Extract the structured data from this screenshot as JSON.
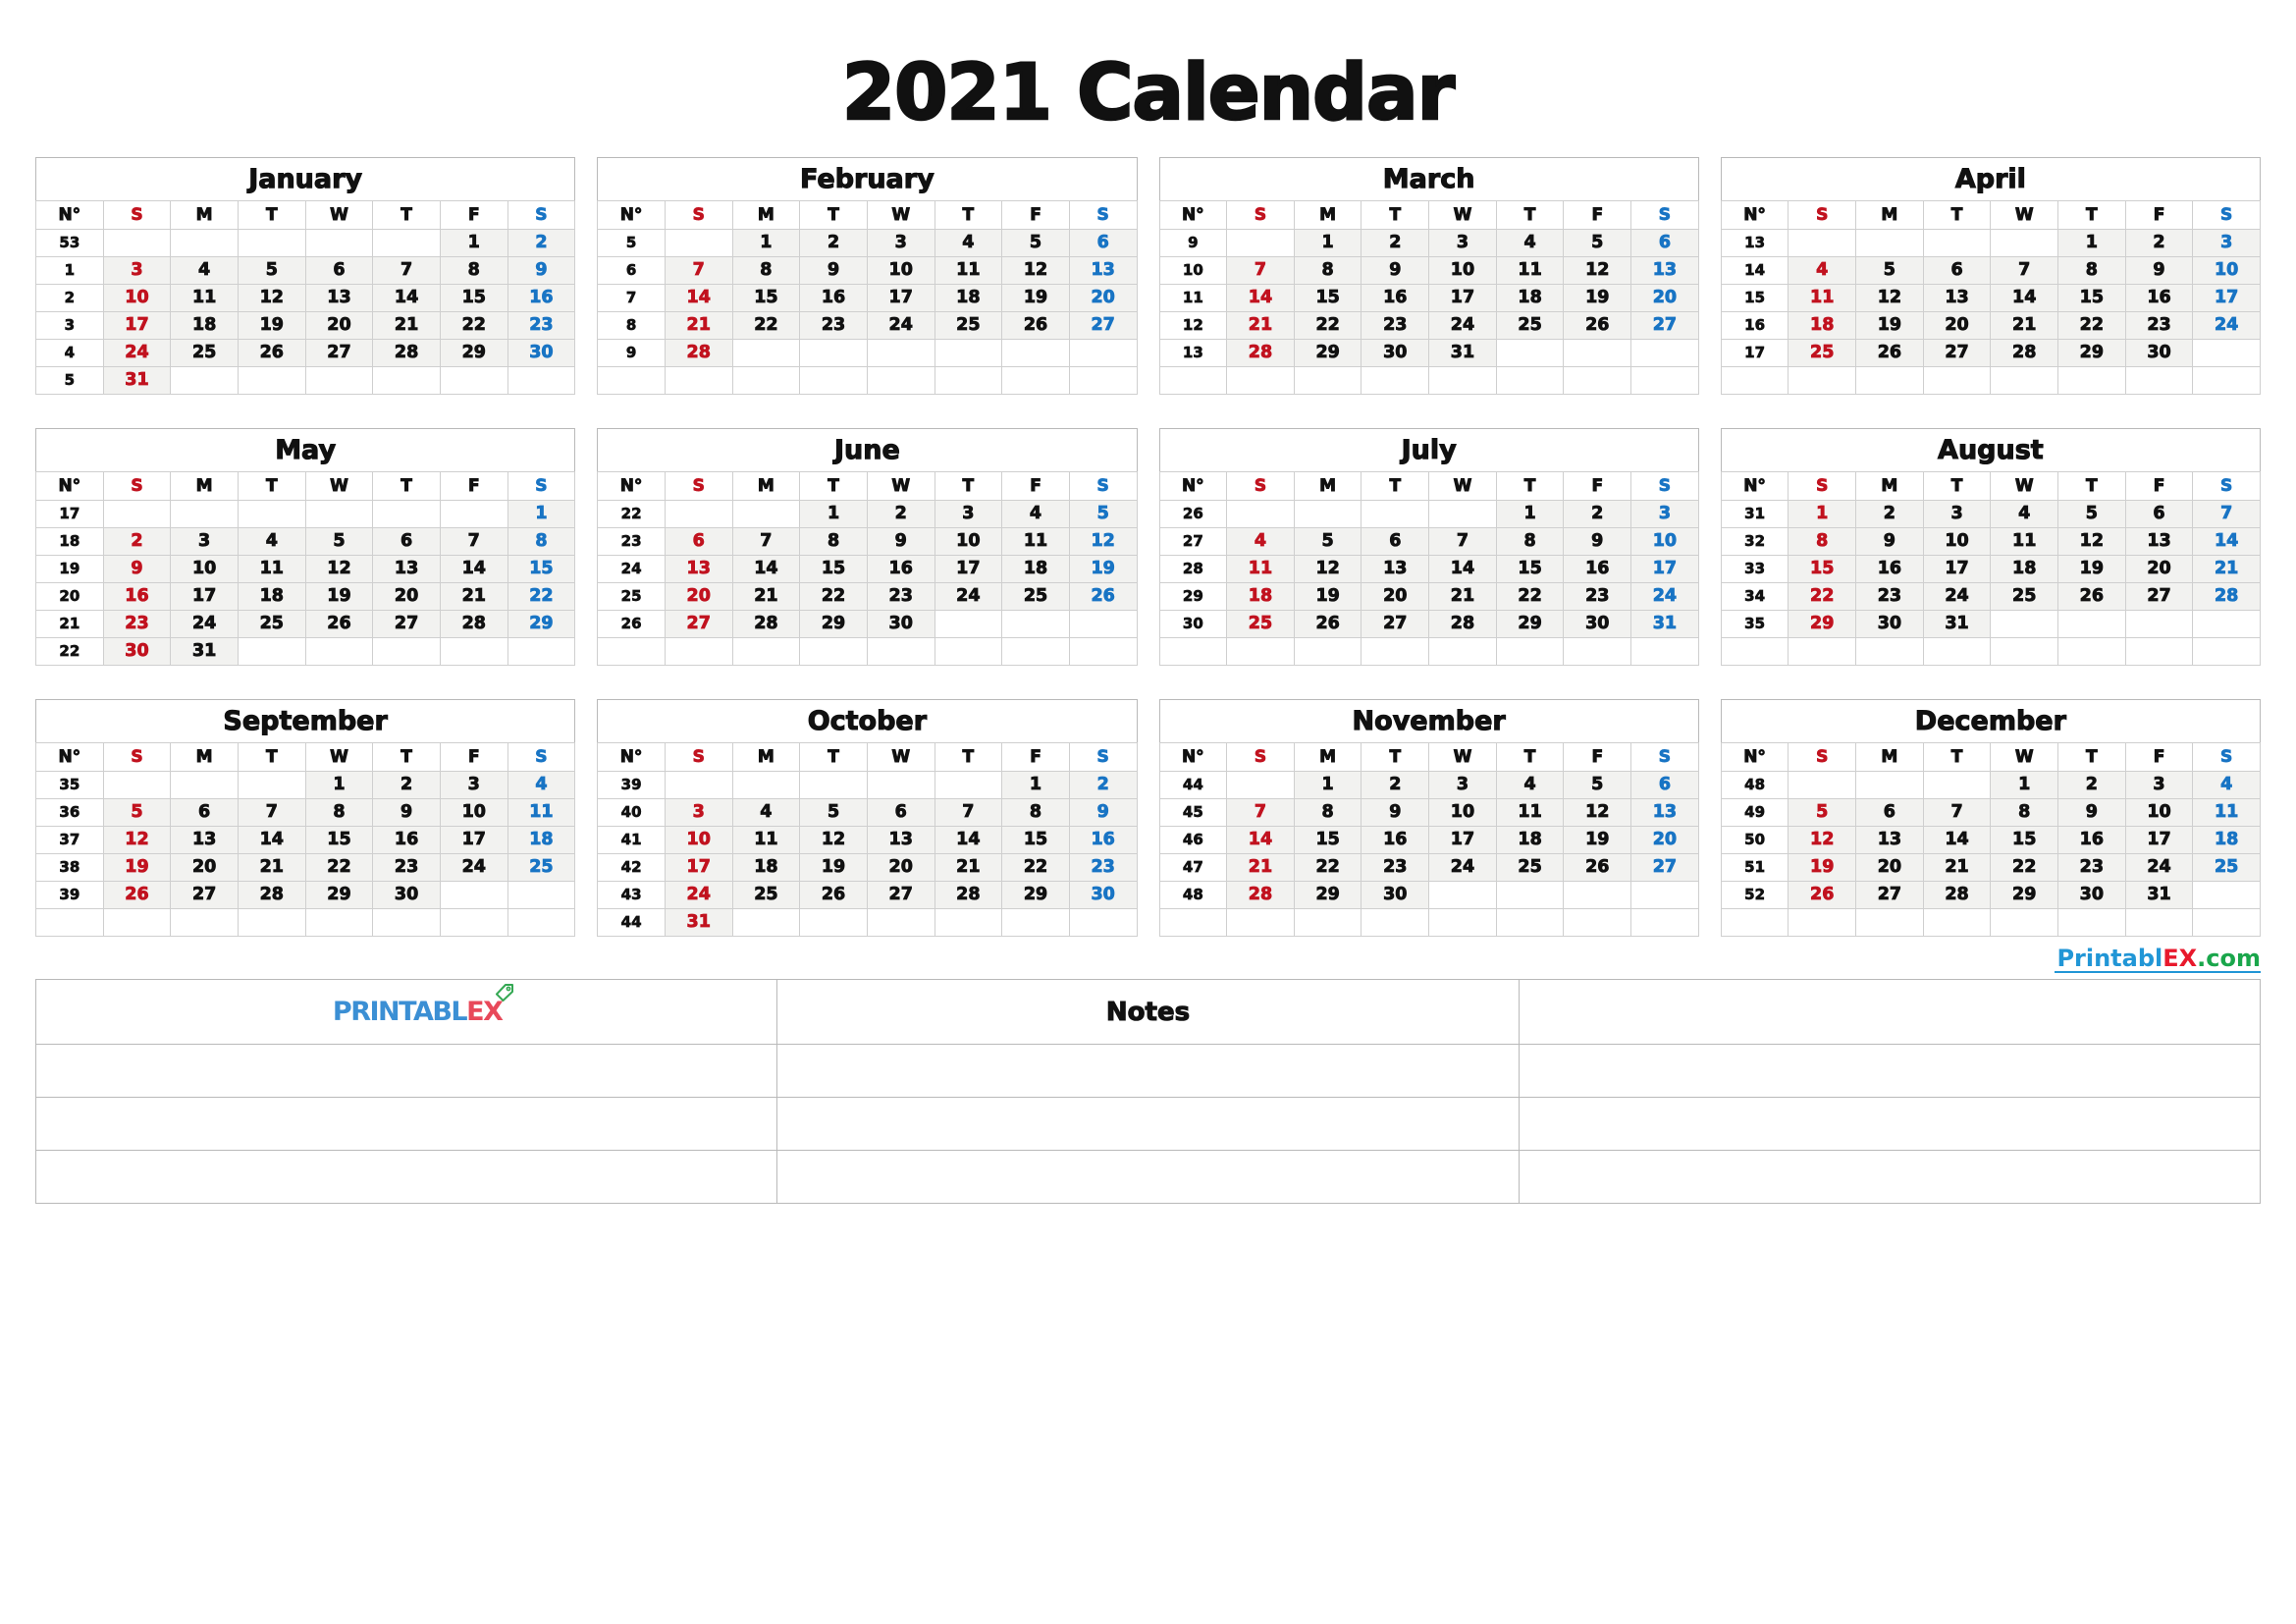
{
  "title": "2021 Calendar",
  "year": 2021,
  "colors": {
    "sunday": "#c1121f",
    "saturday": "#1874c4",
    "weekday": "#111111",
    "filled_cell_bg": "#f2f2f0",
    "grid_line": "#cfcfcf",
    "brand_blue": "#2196d6",
    "brand_red": "#e8192c",
    "brand_green": "#1aa64b"
  },
  "weekday_headers": {
    "week_number": "N°",
    "days": [
      "S",
      "M",
      "T",
      "W",
      "T",
      "F",
      "S"
    ]
  },
  "notes": {
    "title": "Notes",
    "rows": 3,
    "columns": 3,
    "cells": [
      [
        "",
        "",
        ""
      ],
      [
        "",
        "",
        ""
      ],
      [
        "",
        "",
        ""
      ]
    ]
  },
  "brand": {
    "footer_text_blue": "Printabl",
    "footer_text_red": "EX",
    "footer_text_green": ".com",
    "logo_text_blue": "PRINTABL",
    "logo_text_red": "EX",
    "logo_icon": "tag-icon"
  },
  "chart_data": {
    "type": "table",
    "title": "2021 Calendar",
    "description": "Twelve-month 2021 calendar grid with ISO week numbers (N° column), weeks starting Sunday.",
    "months": [
      {
        "name": "January",
        "weeks": [
          {
            "n": "53",
            "days": [
              "",
              "",
              "",
              "",
              "",
              "1",
              "2"
            ]
          },
          {
            "n": "1",
            "days": [
              "3",
              "4",
              "5",
              "6",
              "7",
              "8",
              "9"
            ]
          },
          {
            "n": "2",
            "days": [
              "10",
              "11",
              "12",
              "13",
              "14",
              "15",
              "16"
            ]
          },
          {
            "n": "3",
            "days": [
              "17",
              "18",
              "19",
              "20",
              "21",
              "22",
              "23"
            ]
          },
          {
            "n": "4",
            "days": [
              "24",
              "25",
              "26",
              "27",
              "28",
              "29",
              "30"
            ]
          },
          {
            "n": "5",
            "days": [
              "31",
              "",
              "",
              "",
              "",
              "",
              ""
            ]
          }
        ]
      },
      {
        "name": "February",
        "weeks": [
          {
            "n": "5",
            "days": [
              "",
              "1",
              "2",
              "3",
              "4",
              "5",
              "6"
            ]
          },
          {
            "n": "6",
            "days": [
              "7",
              "8",
              "9",
              "10",
              "11",
              "12",
              "13"
            ]
          },
          {
            "n": "7",
            "days": [
              "14",
              "15",
              "16",
              "17",
              "18",
              "19",
              "20"
            ]
          },
          {
            "n": "8",
            "days": [
              "21",
              "22",
              "23",
              "24",
              "25",
              "26",
              "27"
            ]
          },
          {
            "n": "9",
            "days": [
              "28",
              "",
              "",
              "",
              "",
              "",
              ""
            ]
          },
          {
            "n": "",
            "days": [
              "",
              "",
              "",
              "",
              "",
              "",
              ""
            ]
          }
        ]
      },
      {
        "name": "March",
        "weeks": [
          {
            "n": "9",
            "days": [
              "",
              "1",
              "2",
              "3",
              "4",
              "5",
              "6"
            ]
          },
          {
            "n": "10",
            "days": [
              "7",
              "8",
              "9",
              "10",
              "11",
              "12",
              "13"
            ]
          },
          {
            "n": "11",
            "days": [
              "14",
              "15",
              "16",
              "17",
              "18",
              "19",
              "20"
            ]
          },
          {
            "n": "12",
            "days": [
              "21",
              "22",
              "23",
              "24",
              "25",
              "26",
              "27"
            ]
          },
          {
            "n": "13",
            "days": [
              "28",
              "29",
              "30",
              "31",
              "",
              "",
              ""
            ]
          },
          {
            "n": "",
            "days": [
              "",
              "",
              "",
              "",
              "",
              "",
              ""
            ]
          }
        ]
      },
      {
        "name": "April",
        "weeks": [
          {
            "n": "13",
            "days": [
              "",
              "",
              "",
              "",
              "1",
              "2",
              "3"
            ]
          },
          {
            "n": "14",
            "days": [
              "4",
              "5",
              "6",
              "7",
              "8",
              "9",
              "10"
            ]
          },
          {
            "n": "15",
            "days": [
              "11",
              "12",
              "13",
              "14",
              "15",
              "16",
              "17"
            ]
          },
          {
            "n": "16",
            "days": [
              "18",
              "19",
              "20",
              "21",
              "22",
              "23",
              "24"
            ]
          },
          {
            "n": "17",
            "days": [
              "25",
              "26",
              "27",
              "28",
              "29",
              "30",
              ""
            ]
          },
          {
            "n": "",
            "days": [
              "",
              "",
              "",
              "",
              "",
              "",
              ""
            ]
          }
        ]
      },
      {
        "name": "May",
        "weeks": [
          {
            "n": "17",
            "days": [
              "",
              "",
              "",
              "",
              "",
              "",
              "1"
            ]
          },
          {
            "n": "18",
            "days": [
              "2",
              "3",
              "4",
              "5",
              "6",
              "7",
              "8"
            ]
          },
          {
            "n": "19",
            "days": [
              "9",
              "10",
              "11",
              "12",
              "13",
              "14",
              "15"
            ]
          },
          {
            "n": "20",
            "days": [
              "16",
              "17",
              "18",
              "19",
              "20",
              "21",
              "22"
            ]
          },
          {
            "n": "21",
            "days": [
              "23",
              "24",
              "25",
              "26",
              "27",
              "28",
              "29"
            ]
          },
          {
            "n": "22",
            "days": [
              "30",
              "31",
              "",
              "",
              "",
              "",
              ""
            ]
          }
        ]
      },
      {
        "name": "June",
        "weeks": [
          {
            "n": "22",
            "days": [
              "",
              "",
              "1",
              "2",
              "3",
              "4",
              "5"
            ]
          },
          {
            "n": "23",
            "days": [
              "6",
              "7",
              "8",
              "9",
              "10",
              "11",
              "12"
            ]
          },
          {
            "n": "24",
            "days": [
              "13",
              "14",
              "15",
              "16",
              "17",
              "18",
              "19"
            ]
          },
          {
            "n": "25",
            "days": [
              "20",
              "21",
              "22",
              "23",
              "24",
              "25",
              "26"
            ]
          },
          {
            "n": "26",
            "days": [
              "27",
              "28",
              "29",
              "30",
              "",
              "",
              ""
            ]
          },
          {
            "n": "",
            "days": [
              "",
              "",
              "",
              "",
              "",
              "",
              ""
            ]
          }
        ]
      },
      {
        "name": "July",
        "weeks": [
          {
            "n": "26",
            "days": [
              "",
              "",
              "",
              "",
              "1",
              "2",
              "3"
            ]
          },
          {
            "n": "27",
            "days": [
              "4",
              "5",
              "6",
              "7",
              "8",
              "9",
              "10"
            ]
          },
          {
            "n": "28",
            "days": [
              "11",
              "12",
              "13",
              "14",
              "15",
              "16",
              "17"
            ]
          },
          {
            "n": "29",
            "days": [
              "18",
              "19",
              "20",
              "21",
              "22",
              "23",
              "24"
            ]
          },
          {
            "n": "30",
            "days": [
              "25",
              "26",
              "27",
              "28",
              "29",
              "30",
              "31"
            ]
          },
          {
            "n": "",
            "days": [
              "",
              "",
              "",
              "",
              "",
              "",
              ""
            ]
          }
        ]
      },
      {
        "name": "August",
        "weeks": [
          {
            "n": "31",
            "days": [
              "1",
              "2",
              "3",
              "4",
              "5",
              "6",
              "7"
            ]
          },
          {
            "n": "32",
            "days": [
              "8",
              "9",
              "10",
              "11",
              "12",
              "13",
              "14"
            ]
          },
          {
            "n": "33",
            "days": [
              "15",
              "16",
              "17",
              "18",
              "19",
              "20",
              "21"
            ]
          },
          {
            "n": "34",
            "days": [
              "22",
              "23",
              "24",
              "25",
              "26",
              "27",
              "28"
            ]
          },
          {
            "n": "35",
            "days": [
              "29",
              "30",
              "31",
              "",
              "",
              "",
              ""
            ]
          },
          {
            "n": "",
            "days": [
              "",
              "",
              "",
              "",
              "",
              "",
              ""
            ]
          }
        ]
      },
      {
        "name": "September",
        "weeks": [
          {
            "n": "35",
            "days": [
              "",
              "",
              "",
              "1",
              "2",
              "3",
              "4"
            ]
          },
          {
            "n": "36",
            "days": [
              "5",
              "6",
              "7",
              "8",
              "9",
              "10",
              "11"
            ]
          },
          {
            "n": "37",
            "days": [
              "12",
              "13",
              "14",
              "15",
              "16",
              "17",
              "18"
            ]
          },
          {
            "n": "38",
            "days": [
              "19",
              "20",
              "21",
              "22",
              "23",
              "24",
              "25"
            ]
          },
          {
            "n": "39",
            "days": [
              "26",
              "27",
              "28",
              "29",
              "30",
              "",
              ""
            ]
          },
          {
            "n": "",
            "days": [
              "",
              "",
              "",
              "",
              "",
              "",
              ""
            ]
          }
        ]
      },
      {
        "name": "October",
        "weeks": [
          {
            "n": "39",
            "days": [
              "",
              "",
              "",
              "",
              "",
              "1",
              "2"
            ]
          },
          {
            "n": "40",
            "days": [
              "3",
              "4",
              "5",
              "6",
              "7",
              "8",
              "9"
            ]
          },
          {
            "n": "41",
            "days": [
              "10",
              "11",
              "12",
              "13",
              "14",
              "15",
              "16"
            ]
          },
          {
            "n": "42",
            "days": [
              "17",
              "18",
              "19",
              "20",
              "21",
              "22",
              "23"
            ]
          },
          {
            "n": "43",
            "days": [
              "24",
              "25",
              "26",
              "27",
              "28",
              "29",
              "30"
            ]
          },
          {
            "n": "44",
            "days": [
              "31",
              "",
              "",
              "",
              "",
              "",
              ""
            ]
          }
        ]
      },
      {
        "name": "November",
        "weeks": [
          {
            "n": "44",
            "days": [
              "",
              "1",
              "2",
              "3",
              "4",
              "5",
              "6"
            ]
          },
          {
            "n": "45",
            "days": [
              "7",
              "8",
              "9",
              "10",
              "11",
              "12",
              "13"
            ]
          },
          {
            "n": "46",
            "days": [
              "14",
              "15",
              "16",
              "17",
              "18",
              "19",
              "20"
            ]
          },
          {
            "n": "47",
            "days": [
              "21",
              "22",
              "23",
              "24",
              "25",
              "26",
              "27"
            ]
          },
          {
            "n": "48",
            "days": [
              "28",
              "29",
              "30",
              "",
              "",
              "",
              ""
            ]
          },
          {
            "n": "",
            "days": [
              "",
              "",
              "",
              "",
              "",
              "",
              ""
            ]
          }
        ]
      },
      {
        "name": "December",
        "weeks": [
          {
            "n": "48",
            "days": [
              "",
              "",
              "",
              "1",
              "2",
              "3",
              "4"
            ]
          },
          {
            "n": "49",
            "days": [
              "5",
              "6",
              "7",
              "8",
              "9",
              "10",
              "11"
            ]
          },
          {
            "n": "50",
            "days": [
              "12",
              "13",
              "14",
              "15",
              "16",
              "17",
              "18"
            ]
          },
          {
            "n": "51",
            "days": [
              "19",
              "20",
              "21",
              "22",
              "23",
              "24",
              "25"
            ]
          },
          {
            "n": "52",
            "days": [
              "26",
              "27",
              "28",
              "29",
              "30",
              "31",
              ""
            ]
          },
          {
            "n": "",
            "days": [
              "",
              "",
              "",
              "",
              "",
              "",
              ""
            ]
          }
        ]
      }
    ]
  }
}
